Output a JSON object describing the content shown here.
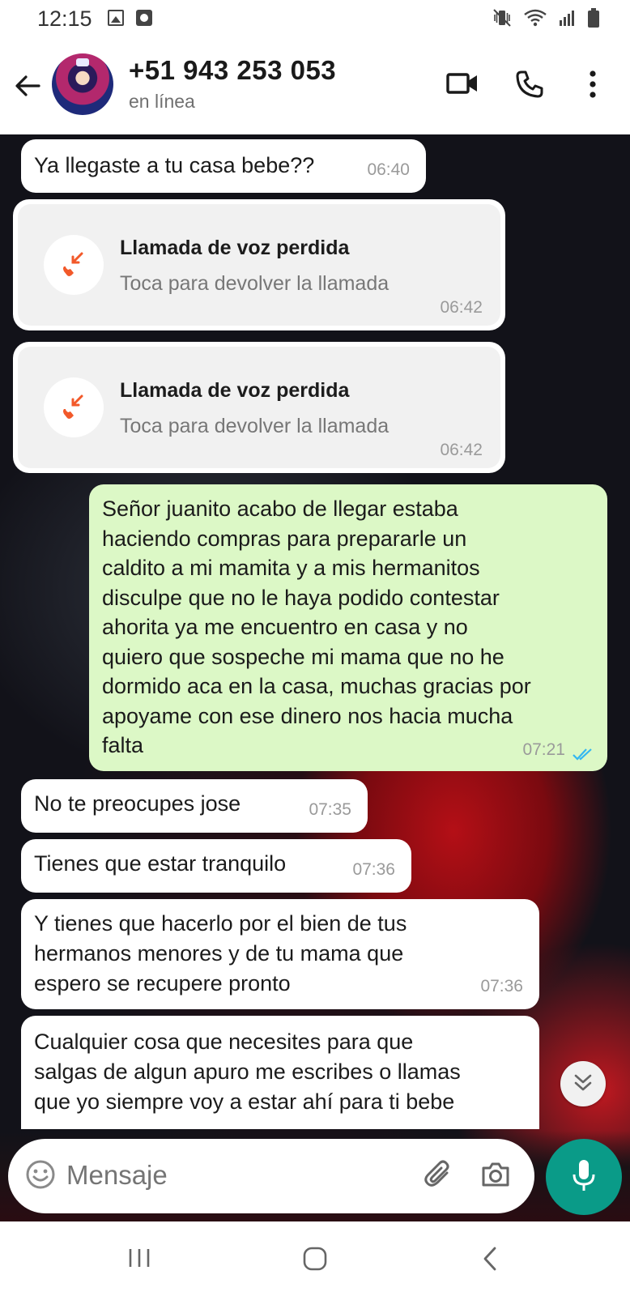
{
  "status_bar": {
    "time": "12:15"
  },
  "header": {
    "contact_name": "+51 943 253 053",
    "contact_status": "en línea"
  },
  "messages": [
    {
      "direction": "in",
      "text": "Ya llegaste a tu casa bebe??",
      "time": "06:40"
    },
    {
      "direction": "in",
      "type": "missed-call",
      "title": "Llamada de voz perdida",
      "subtitle": "Toca para devolver la llamada",
      "time": "06:42"
    },
    {
      "direction": "in",
      "type": "missed-call",
      "title": "Llamada de voz perdida",
      "subtitle": "Toca para devolver la llamada",
      "time": "06:42"
    },
    {
      "direction": "out",
      "lines": [
        "Señor juanito acabo de llegar estaba",
        "haciendo compras para prepararle un",
        "caldito a mi mamita y a mis hermanitos",
        "disculpe que no le haya podido contestar",
        "ahorita ya me encuentro en casa y no",
        "quiero que sospeche mi mama que no he",
        "dormido aca en la casa, muchas gracias por",
        "apoyame con ese dinero nos hacia mucha",
        "falta"
      ],
      "time": "07:21",
      "read": true
    },
    {
      "direction": "in",
      "text": "No te preocupes jose",
      "time": "07:35"
    },
    {
      "direction": "in",
      "text": "Tienes que estar tranquilo",
      "time": "07:36"
    },
    {
      "direction": "in",
      "lines": [
        "Y tienes que hacerlo por el bien de tus",
        "hermanos menores y de tu mama que",
        "espero se recupere pronto"
      ],
      "time": "07:36"
    },
    {
      "direction": "in",
      "lines": [
        "Cualquier cosa que necesites para que",
        "salgas de algun apuro me escribes o llamas",
        "que yo siempre voy a estar ahí para ti bebe"
      ]
    }
  ],
  "composer": {
    "placeholder": "Mensaje"
  },
  "colors": {
    "outgoing_bubble": "#dcf8c6",
    "incoming_bubble": "#ffffff",
    "missed_call_icon": "#f2592a",
    "mic_button": "#0a9b88",
    "read_ticks": "#34b7f1"
  },
  "icons": {
    "header": [
      "back-arrow-icon",
      "video-call-icon",
      "voice-call-icon",
      "more-menu-icon"
    ],
    "composer": [
      "emoji-icon",
      "attach-icon",
      "camera-icon",
      "mic-icon"
    ],
    "navigation": [
      "recent-apps-icon",
      "home-icon",
      "back-icon"
    ]
  }
}
